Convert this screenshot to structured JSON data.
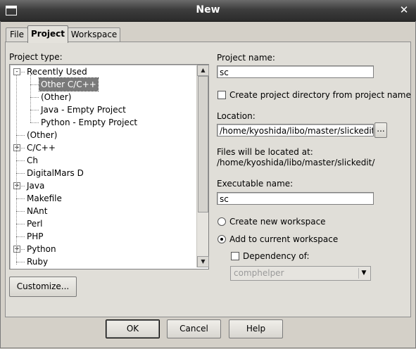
{
  "window": {
    "title": "New"
  },
  "tabs": [
    {
      "label": "File"
    },
    {
      "label": "Project"
    },
    {
      "label": "Workspace"
    }
  ],
  "project_type": {
    "label": "Project type:",
    "items": [
      {
        "label": "Recently Used",
        "level": 0,
        "expander": "-"
      },
      {
        "label": "Other C/C++",
        "level": 1,
        "selected": true
      },
      {
        "label": "(Other)",
        "level": 1
      },
      {
        "label": "Java - Empty Project",
        "level": 1
      },
      {
        "label": "Python - Empty Project",
        "level": 1
      },
      {
        "label": "(Other)",
        "level": 0
      },
      {
        "label": "C/C++",
        "level": 0,
        "expander": "+"
      },
      {
        "label": "Ch",
        "level": 0
      },
      {
        "label": "DigitalMars D",
        "level": 0
      },
      {
        "label": "Java",
        "level": 0,
        "expander": "+"
      },
      {
        "label": "Makefile",
        "level": 0
      },
      {
        "label": "NAnt",
        "level": 0
      },
      {
        "label": "Perl",
        "level": 0
      },
      {
        "label": "PHP",
        "level": 0
      },
      {
        "label": "Python",
        "level": 0,
        "expander": "+"
      },
      {
        "label": "Ruby",
        "level": 0
      }
    ]
  },
  "customize_button": "Customize...",
  "project_name": {
    "label": "Project name:",
    "value": "sc"
  },
  "create_dir_checkbox": {
    "label": "Create project directory from project name",
    "checked": false
  },
  "location": {
    "label": "Location:",
    "value": "/home/kyoshida/libo/master/slickedit",
    "browse_label": "..."
  },
  "files_location": {
    "label": "Files will be located at:",
    "path": "/home/kyoshida/libo/master/slickedit/"
  },
  "executable_name": {
    "label": "Executable name:",
    "value": "sc"
  },
  "workspace_options": {
    "create_new": {
      "label": "Create new workspace",
      "selected": false
    },
    "add_current": {
      "label": "Add to current workspace",
      "selected": true
    }
  },
  "dependency": {
    "label": "Dependency of:",
    "checked": false,
    "value": "comphelper"
  },
  "buttons": {
    "ok": "OK",
    "cancel": "Cancel",
    "help": "Help"
  }
}
